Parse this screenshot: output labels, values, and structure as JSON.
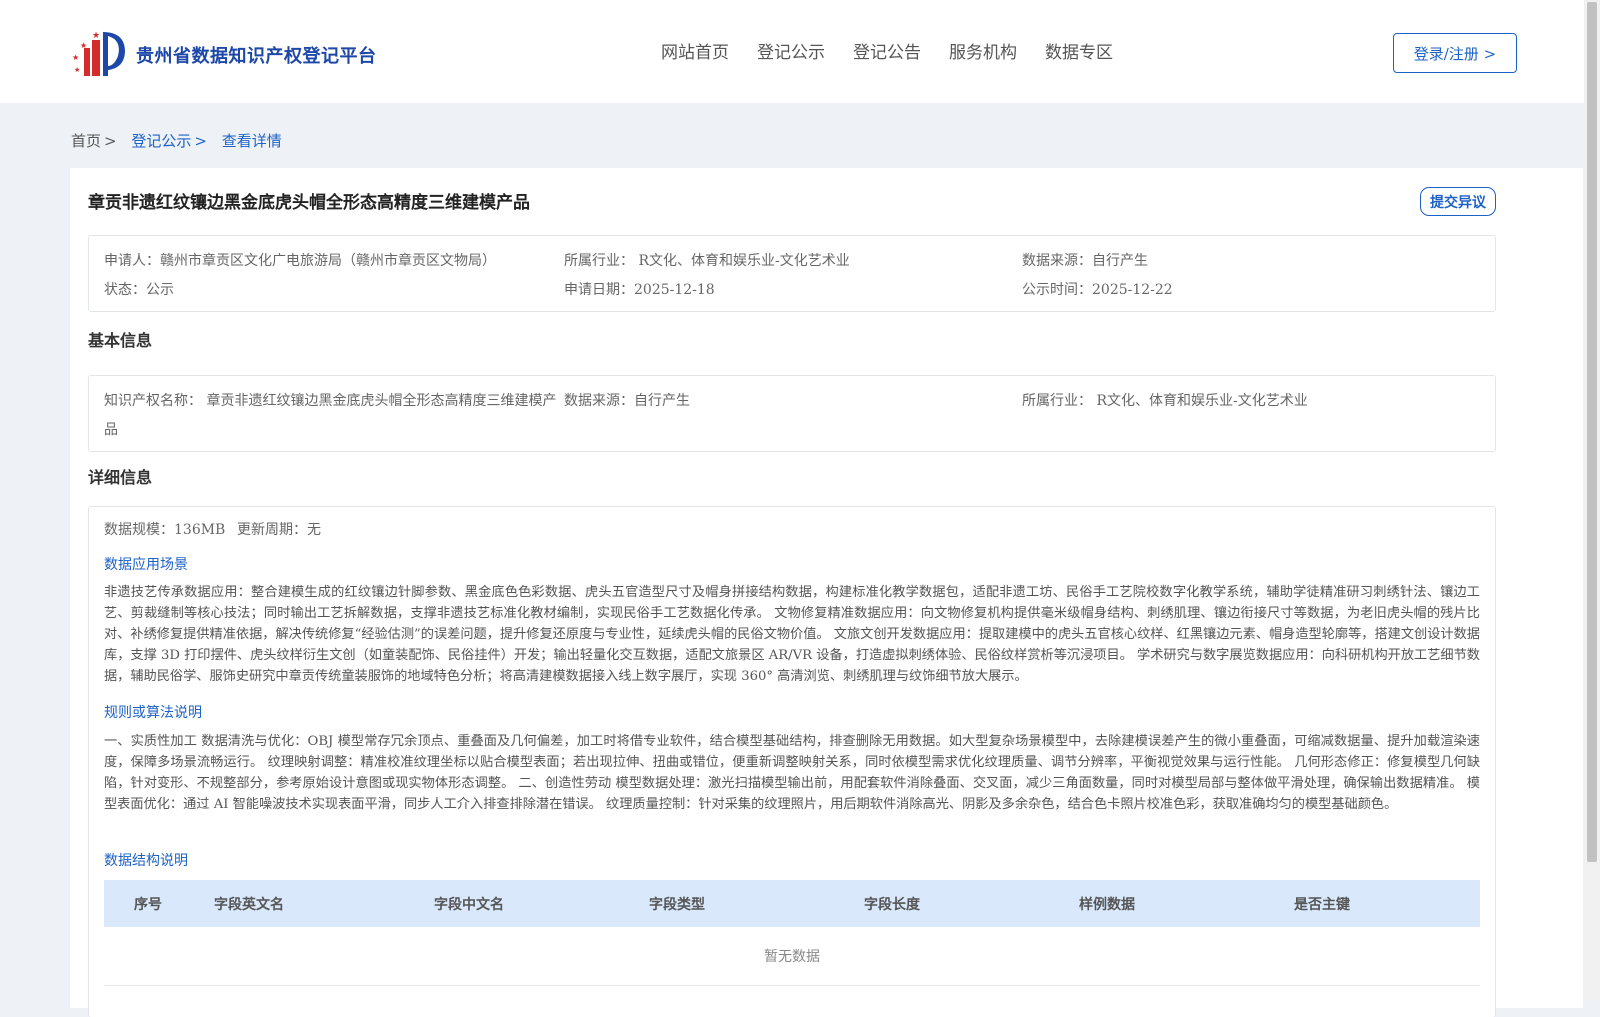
{
  "header": {
    "brand": "贵州省数据知识产权登记平台",
    "nav": [
      "网站首页",
      "登记公示",
      "登记公告",
      "服务机构",
      "数据专区"
    ],
    "login": "登录/注册 >"
  },
  "breadcrumb": {
    "home": "首页",
    "public": "登记公示",
    "current": "查看详情",
    "sep": ">"
  },
  "detail": {
    "title": "章贡非遗红纹镶边黑金底虎头帽全形态高精度三维建模产品",
    "objection": "提交异议",
    "summary": {
      "applicant": "申请人：赣州市章贡区文化广电旅游局（赣州市章贡区文物局）",
      "industry": "所属行业： R文化、体育和娱乐业-文化艺术业",
      "source": "数据来源：自行产生",
      "status": "状态：公示",
      "apply_date": "申请日期：2025-12-18",
      "publish_date": "公示时间：2025-12-22"
    }
  },
  "basic": {
    "heading": "基本信息",
    "name_line1": "知识产权名称： 章贡非遗红纹镶边黑金底虎头帽全形态高精度三维建模产",
    "name_line2": "品",
    "source": "数据来源：自行产生",
    "industry": "所属行业： R文化、体育和娱乐业-文化艺术业"
  },
  "details": {
    "heading": "详细信息",
    "scale": "数据规模：136MB",
    "cycle": "更新周期：无",
    "scene_title": "数据应用场景",
    "scene_text": "非遗技艺传承数据应用：整合建模生成的红纹镶边针脚参数、黑金底色色彩数据、虎头五官造型尺寸及帽身拼接结构数据，构建标准化教学数据包，适配非遗工坊、民俗手工艺院校数字化教学系统，辅助学徒精准研习刺绣针法、镶边工艺、剪裁缝制等核心技法；同时输出工艺拆解数据，支撑非遗技艺标准化教材编制，实现民俗手工艺数据化传承。 文物修复精准数据应用：向文物修复机构提供毫米级帽身结构、刺绣肌理、镶边衔接尺寸等数据，为老旧虎头帽的残片比对、补绣修复提供精准依据，解决传统修复“经验估测”的误差问题，提升修复还原度与专业性，延续虎头帽的民俗文物价值。 文旅文创开发数据应用：提取建模中的虎头五官核心纹样、红黑镶边元素、帽身造型轮廓等，搭建文创设计数据库，支撑 3D 打印摆件、虎头纹样衍生文创（如童装配饰、民俗挂件）开发；输出轻量化交互数据，适配文旅景区 AR/VR 设备，打造虚拟刺绣体验、民俗纹样赏析等沉浸项目。 学术研究与数字展览数据应用：向科研机构开放工艺细节数据，辅助民俗学、服饰史研究中章贡传统童装服饰的地域特色分析；将高清建模数据接入线上数字展厅，实现 360° 高清浏览、刺绣肌理与纹饰细节放大展示。",
    "rule_title": "规则或算法说明",
    "rule_text": "一、实质性加工 数据清洗与优化：OBJ 模型常存冗余顶点、重叠面及几何偏差，加工时将借专业软件，结合模型基础结构，排查删除无用数据。如大型复杂场景模型中，去除建模误差产生的微小重叠面，可缩减数据量、提升加载渲染速度，保障多场景流畅运行。 纹理映射调整：精准校准纹理坐标以贴合模型表面；若出现拉伸、扭曲或错位，便重新调整映射关系，同时依模型需求优化纹理质量、调节分辨率，平衡视觉效果与运行性能。 几何形态修正：修复模型几何缺陷，针对变形、不规整部分，参考原始设计意图或现实物体形态调整。 二、创造性劳动 模型数据处理：激光扫描模型输出前，用配套软件消除叠面、交叉面，减少三角面数量，同时对模型局部与整体做平滑处理，确保输出数据精准。 模型表面优化：通过 AI 智能噪波技术实现表面平滑，同步人工介入排查排除潜在错误。 纹理质量控制：针对采集的纹理照片，用后期软件消除高光、阴影及多余杂色，结合色卡照片校准色彩，获取准确均匀的模型基础颜色。",
    "struct_title": "数据结构说明",
    "table_headers": [
      "序号",
      "字段英文名",
      "字段中文名",
      "字段类型",
      "字段长度",
      "样例数据",
      "是否主键"
    ],
    "empty": "暂无数据"
  }
}
